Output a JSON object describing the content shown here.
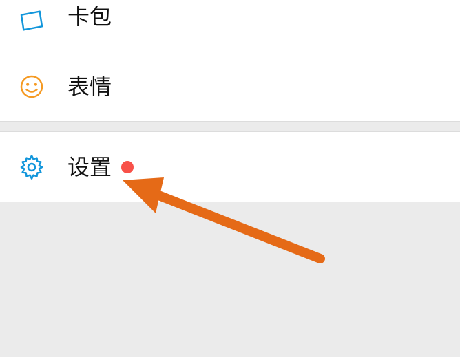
{
  "items": [
    {
      "id": "card-pack",
      "label": "卡包",
      "icon": "wallet-icon",
      "badge": false
    },
    {
      "id": "stickers",
      "label": "表情",
      "icon": "smile-icon",
      "badge": false
    },
    {
      "id": "settings",
      "label": "设置",
      "icon": "gear-icon",
      "badge": true
    }
  ],
  "colors": {
    "icon_blue": "#1296db",
    "icon_orange": "#f59a23",
    "badge": "#f85149",
    "arrow": "#e56a17"
  }
}
